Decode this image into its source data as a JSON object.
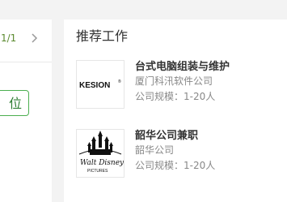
{
  "left_panel": {
    "pager_text": "1/1",
    "next_icon": "chevron-right-icon",
    "position_button_label": "位"
  },
  "recommended": {
    "title": "推荐工作",
    "jobs": [
      {
        "title": "台式电脑组装与维护",
        "company": "厦门科汛软件公司",
        "size": "公司规模：1-20人",
        "logo_name": "kesion-logo",
        "logo_text": "KESION®"
      },
      {
        "title": "韶华公司兼职",
        "company": "韶华公司",
        "size": "公司规模：1-20人",
        "logo_name": "walt-disney-pictures-logo",
        "logo_text": "Walt Disney PICTURES"
      }
    ]
  },
  "colors": {
    "background": "#f3f3f3",
    "accent_green": "#4caf50"
  }
}
